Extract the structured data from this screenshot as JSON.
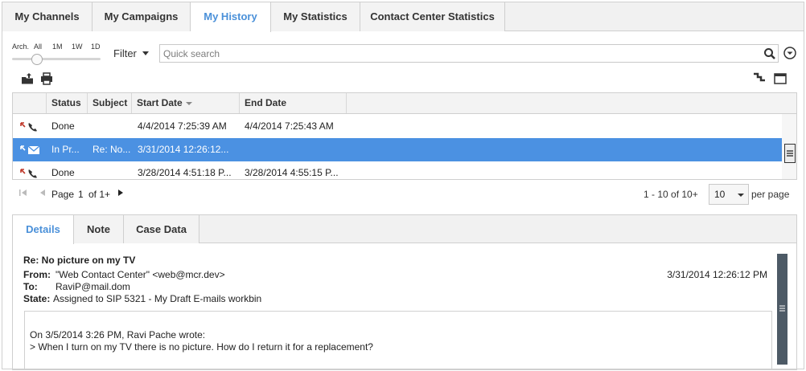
{
  "top_tabs": [
    {
      "label": "My Channels",
      "active": false
    },
    {
      "label": "My Campaigns",
      "active": false
    },
    {
      "label": "My History",
      "active": true
    },
    {
      "label": "My Statistics",
      "active": false
    },
    {
      "label": "Contact Center Statistics",
      "active": false
    }
  ],
  "toolbar": {
    "slider_labels": [
      "Arch.",
      "All",
      "1M",
      "1W",
      "1D"
    ],
    "filter_label": "Filter",
    "search_placeholder": "Quick search",
    "search_value": ""
  },
  "grid": {
    "columns": [
      "",
      "Status",
      "Subject",
      "Start Date",
      "End Date"
    ],
    "sorted_column": "Start Date",
    "rows": [
      {
        "type": "phone",
        "status": "Done",
        "subject": "",
        "start": "4/4/2014 7:25:39 AM",
        "end": "4/4/2014 7:25:43 AM",
        "selected": false
      },
      {
        "type": "email",
        "status": "In Pr...",
        "subject": "Re: No...",
        "start": "3/31/2014 12:26:12...",
        "end": "",
        "selected": true
      },
      {
        "type": "phone",
        "status": "Done",
        "subject": "",
        "start": "3/28/2014 4:51:18 P...",
        "end": "3/28/2014 4:55:15 P...",
        "selected": false
      }
    ]
  },
  "pager": {
    "page_label": "Page",
    "page": "1",
    "of_label": "of 1+",
    "range": "1 - 10 of 10+",
    "per_page_value": "10",
    "per_page_label": "per page"
  },
  "details": {
    "tabs": [
      {
        "label": "Details",
        "active": true
      },
      {
        "label": "Note",
        "active": false
      },
      {
        "label": "Case Data",
        "active": false
      }
    ],
    "subject": "Re: No picture on my TV",
    "from_label": "From:",
    "from_value": "\"Web Contact Center\" <web@mcr.dev>",
    "to_label": "To:",
    "to_value": "RaviP@mail.dom",
    "state_label": "State:",
    "state_value": "Assigned to SIP 5321 - My Draft E-mails workbin",
    "date": "3/31/2014 12:26:12 PM",
    "message_lines": [
      "On 3/5/2014 3:26 PM, Ravi Pache wrote:",
      "> When I turn on my TV there is no picture. How do I return it for a replacement?"
    ]
  },
  "colors": {
    "accent": "#4a90d9",
    "selected_row": "#4b91e2",
    "scrollbar": "#4d5a66"
  }
}
